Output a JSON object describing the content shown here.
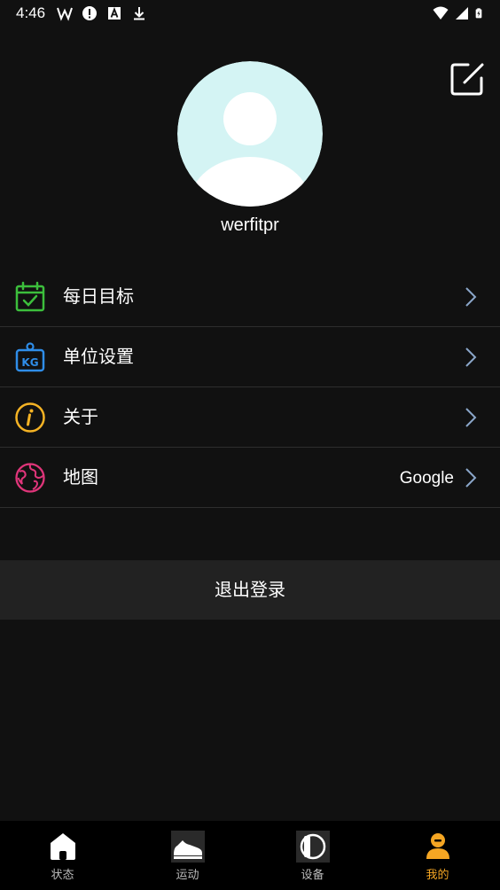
{
  "status_bar": {
    "time": "4:46",
    "left_icons": [
      "w-logo-icon",
      "alert-icon",
      "a-box-icon",
      "download-icon"
    ],
    "right_icons": [
      "wifi-icon",
      "signal-icon",
      "battery-charging-icon"
    ]
  },
  "profile": {
    "username": "werfitpr",
    "avatar_bg": "#d4f4f4",
    "avatar_fg": "#ffffff",
    "edit_icon": "edit-icon"
  },
  "menu": {
    "items": [
      {
        "label": "每日目标",
        "icon": "calendar-check-icon",
        "icon_color": "#3cbf3c",
        "value": ""
      },
      {
        "label": "单位设置",
        "icon": "kg-weight-icon",
        "icon_color": "#2f8de8",
        "value": ""
      },
      {
        "label": "关于",
        "icon": "info-icon",
        "icon_color": "#f5b324",
        "value": ""
      },
      {
        "label": "地图",
        "icon": "globe-icon",
        "icon_color": "#e0357a",
        "value": "Google"
      }
    ]
  },
  "logout": {
    "label": "退出登录"
  },
  "nav": {
    "active_color": "#f5a623",
    "items": [
      {
        "label": "状态",
        "icon": "home-icon"
      },
      {
        "label": "运动",
        "icon": "shoe-icon"
      },
      {
        "label": "设备",
        "icon": "watch-icon"
      },
      {
        "label": "我的",
        "icon": "person-icon"
      }
    ]
  }
}
